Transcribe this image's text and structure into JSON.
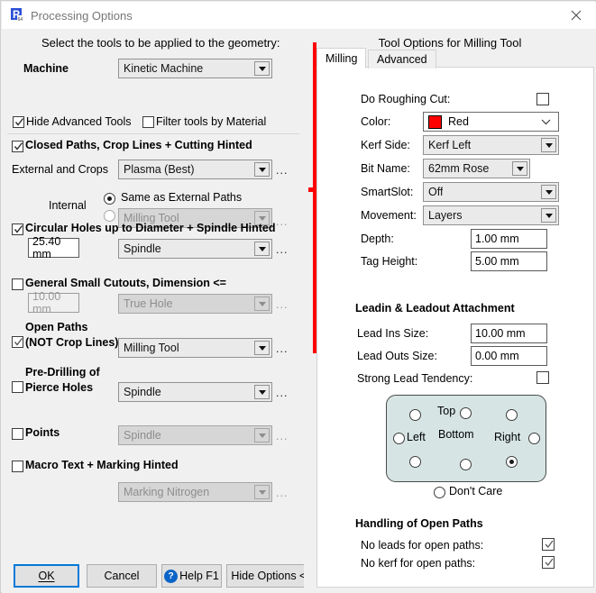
{
  "window": {
    "title": "Processing Options",
    "icon": "app-p-icon",
    "close_label": "✕"
  },
  "left": {
    "heading": "Select the tools to be applied to the geometry:",
    "machine_label": "Machine",
    "machine_value": "Kinetic Machine",
    "hide_advanced_label": "Hide Advanced Tools",
    "hide_advanced_checked": true,
    "filter_material_label": "Filter tools by Material",
    "filter_material_checked": false,
    "closed_paths_label": "Closed Paths,  Crop Lines  +   Cutting Hinted",
    "closed_paths_checked": true,
    "external_crops_label": "External and Crops",
    "external_crops_value": "Plasma (Best)",
    "internal_label": "Internal",
    "internal_same_label": "Same as External Paths",
    "internal_same_selected": true,
    "internal_tool_selected": false,
    "internal_tool_value": "Milling Tool",
    "circular_holes_label": "Circular Holes up to Diameter   +  Spindle Hinted",
    "circular_holes_checked": true,
    "circular_holes_size": "25.40 mm",
    "circular_holes_tool": "Spindle",
    "general_cutouts_label": "General Small Cutouts, Dimension <=",
    "general_cutouts_checked": false,
    "general_cutouts_size": "10.00 mm",
    "general_cutouts_tool": "True Hole",
    "open_paths_label_1": "Open Paths",
    "open_paths_label_2": "(NOT Crop Lines)",
    "open_paths_checked": true,
    "open_paths_tool": "Milling Tool",
    "predrill_label_1": "Pre-Drilling of",
    "predrill_label_2": "Pierce Holes",
    "predrill_checked": false,
    "predrill_tool": "Spindle",
    "points_label": "Points",
    "points_checked": false,
    "points_tool": "Spindle",
    "macro_text_label": "Macro Text  +  Marking Hinted",
    "macro_text_checked": false,
    "macro_text_tool": "Marking Nitrogen",
    "ellipsis": "...",
    "buttons": {
      "ok": "OK",
      "cancel": "Cancel",
      "help": "Help F1",
      "help_glyph": "?",
      "hide_options": "Hide Options <<"
    }
  },
  "right": {
    "panel_title": "Tool Options for Milling Tool",
    "tabs": [
      {
        "label": "Milling",
        "selected": true
      },
      {
        "label": "Advanced",
        "selected": false
      }
    ],
    "milling": {
      "do_roughing_label": "Do Roughing Cut:",
      "do_roughing_checked": false,
      "color_label": "Color:",
      "color_value": "Red",
      "color_hex": "#fe0000",
      "kerf_side_label": "Kerf Side:",
      "kerf_side_value": "Kerf Left",
      "bit_name_label": "Bit Name:",
      "bit_name_value": "62mm Rose",
      "smartslot_label": "SmartSlot:",
      "smartslot_value": "Off",
      "movement_label": "Movement:",
      "movement_value": "Layers",
      "depth_label": "Depth:",
      "depth_value": "1.00 mm",
      "tag_height_label": "Tag Height:",
      "tag_height_value": "5.00 mm",
      "leadin_heading": "Leadin & Leadout Attachment",
      "lead_ins_label": "Lead Ins Size:",
      "lead_ins_value": "10.00 mm",
      "lead_outs_label": "Lead Outs Size:",
      "lead_outs_value": "0.00 mm",
      "strong_lead_label": "Strong Lead Tendency:",
      "strong_lead_checked": false,
      "lead_direction": {
        "box_color": "#d6e5e4",
        "top_label": "Top",
        "bottom_label": "Bottom",
        "left_label": "Left",
        "right_label": "Right",
        "selected": "bottom-right",
        "dont_care_label": "Don't Care",
        "dont_care_selected": false
      },
      "open_paths_heading": "Handling of Open Paths",
      "no_leads_label": "No leads for open paths:",
      "no_leads_checked": true,
      "no_kerf_label": "No kerf for open paths:",
      "no_kerf_checked": true
    }
  }
}
